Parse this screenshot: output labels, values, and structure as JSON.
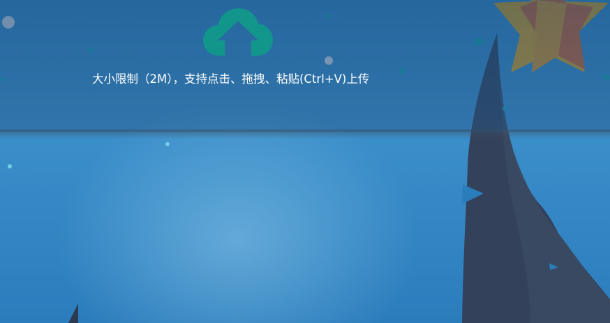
{
  "upload": {
    "icon": "cloud-upload-icon",
    "hint": "大小限制（2M），支持点击、拖拽、粘贴(Ctrl+V)上传"
  },
  "colors": {
    "icon": "#12958a",
    "upload_zone": "#245a8a",
    "background": "#3b8fca",
    "star_front": "#e9b21c",
    "star_back": "#dc6a22",
    "rock": "#2f3d55"
  }
}
